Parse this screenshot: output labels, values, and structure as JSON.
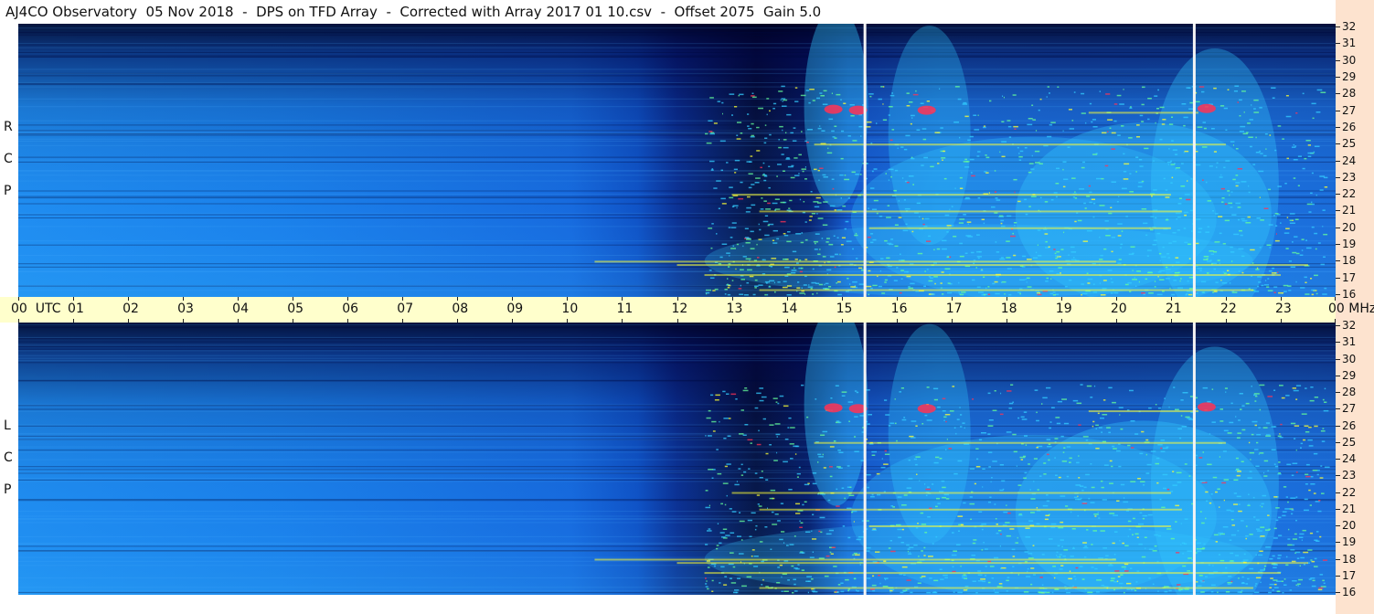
{
  "title": "AJ4CO Observatory  05 Nov 2018  -  DPS on TFD Array  -  Corrected with Array 2017 01 10.csv  -  Offset 2075  Gain 5.0",
  "chart_data": [
    {
      "type": "heatmap",
      "panel": "top",
      "polarization_label": [
        "R",
        "C",
        "P"
      ],
      "x_unit": "UTC",
      "y_unit": "MHz",
      "x_ticks": [
        "00",
        "01",
        "02",
        "03",
        "04",
        "05",
        "06",
        "07",
        "08",
        "09",
        "10",
        "11",
        "12",
        "13",
        "14",
        "15",
        "16",
        "17",
        "18",
        "19",
        "20",
        "21",
        "22",
        "23",
        "00"
      ],
      "y_ticks": [
        32,
        31,
        30,
        29,
        28,
        27,
        26,
        25,
        24,
        23,
        22,
        21,
        20,
        19,
        18,
        17,
        16
      ],
      "ylim": [
        16,
        32
      ],
      "xlim_hours": [
        0,
        24
      ],
      "colormap": [
        "#000020",
        "#0033cc",
        "#0088ff",
        "#33ccff",
        "#66ff99",
        "#ffff33",
        "#ff3355"
      ],
      "markers_utc_hours": [
        15.4,
        21.4
      ]
    },
    {
      "type": "heatmap",
      "panel": "bottom",
      "polarization_label": [
        "L",
        "C",
        "P"
      ],
      "x_unit": "UTC",
      "y_unit": "MHz",
      "x_ticks": [
        "00",
        "01",
        "02",
        "03",
        "04",
        "05",
        "06",
        "07",
        "08",
        "09",
        "10",
        "11",
        "12",
        "13",
        "14",
        "15",
        "16",
        "17",
        "18",
        "19",
        "20",
        "21",
        "22",
        "23",
        "00"
      ],
      "y_ticks": [
        32,
        31,
        30,
        29,
        28,
        27,
        26,
        25,
        24,
        23,
        22,
        21,
        20,
        19,
        18,
        17,
        16
      ],
      "ylim": [
        16,
        32
      ],
      "xlim_hours": [
        0,
        24
      ],
      "colormap": [
        "#000020",
        "#0033cc",
        "#0088ff",
        "#33ccff",
        "#66ff99",
        "#ffff33",
        "#ff3355"
      ],
      "markers_utc_hours": [
        15.4,
        21.4
      ]
    }
  ],
  "axis": {
    "utc_label": "UTC",
    "mhz_label": "MHz"
  }
}
